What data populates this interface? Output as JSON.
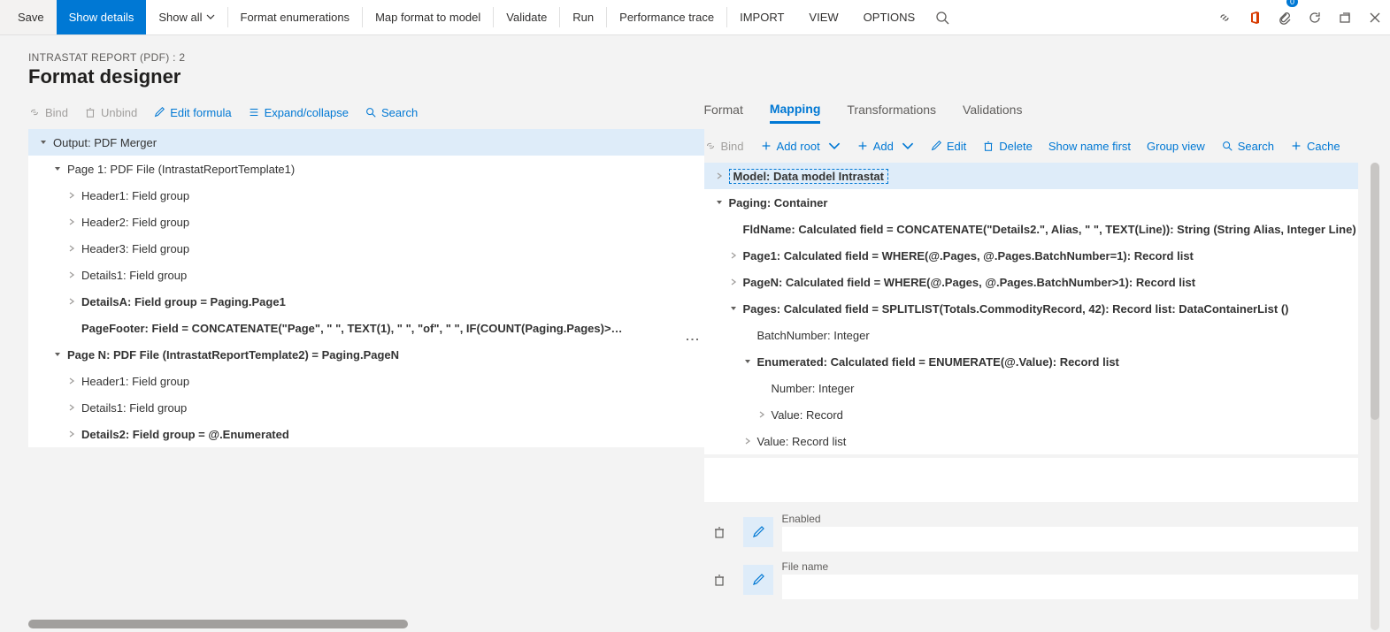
{
  "toolbar": {
    "save": "Save",
    "show_details": "Show details",
    "show_all": "Show all",
    "format_enum": "Format enumerations",
    "map_format": "Map format to model",
    "validate": "Validate",
    "run": "Run",
    "perf_trace": "Performance trace",
    "import": "IMPORT",
    "view": "VIEW",
    "options": "OPTIONS",
    "badge_count": "0"
  },
  "header": {
    "breadcrumb": "INTRASTAT REPORT (PDF) : 2",
    "title": "Format designer"
  },
  "left_toolbar": {
    "bind": "Bind",
    "unbind": "Unbind",
    "edit_formula": "Edit formula",
    "expand": "Expand/collapse",
    "search": "Search"
  },
  "left_tree": [
    {
      "depth": 0,
      "arrow": "down",
      "text": "Output: PDF Merger",
      "selected": true
    },
    {
      "depth": 1,
      "arrow": "down",
      "text": "Page 1: PDF File (IntrastatReportTemplate1)"
    },
    {
      "depth": 2,
      "arrow": "right",
      "text": "Header1: Field group"
    },
    {
      "depth": 2,
      "arrow": "right",
      "text": "Header2: Field group"
    },
    {
      "depth": 2,
      "arrow": "right",
      "text": "Header3: Field group"
    },
    {
      "depth": 2,
      "arrow": "right",
      "text": "Details1: Field group"
    },
    {
      "depth": 2,
      "arrow": "right",
      "text": "DetailsA: Field group = Paging.Page1",
      "bold": true
    },
    {
      "depth": 2,
      "arrow": "blank",
      "text": "PageFooter: Field = CONCATENATE(\"Page\", \" \", TEXT(1), \" \", \"of\", \" \", IF(COUNT(Paging.Pages)>…",
      "bold": true
    },
    {
      "depth": 1,
      "arrow": "down",
      "text": "Page N: PDF File (IntrastatReportTemplate2) = Paging.PageN",
      "bold": true
    },
    {
      "depth": 2,
      "arrow": "right",
      "text": "Header1: Field group"
    },
    {
      "depth": 2,
      "arrow": "right",
      "text": "Details1: Field group"
    },
    {
      "depth": 2,
      "arrow": "right",
      "text": "Details2: Field group = @.Enumerated",
      "bold": true
    }
  ],
  "tabs": {
    "format": "Format",
    "mapping": "Mapping",
    "transformations": "Transformations",
    "validations": "Validations"
  },
  "right_toolbar": {
    "bind": "Bind",
    "add_root": "Add root",
    "add": "Add",
    "edit": "Edit",
    "delete": "Delete",
    "show_name": "Show name first",
    "group_view": "Group view",
    "search": "Search",
    "cache": "Cache"
  },
  "right_tree": [
    {
      "depth": 0,
      "arrow": "right",
      "text": "Model: Data model Intrastat",
      "bold": true,
      "dashed": true
    },
    {
      "depth": 0,
      "arrow": "down",
      "text": "Paging: Container",
      "bold": true
    },
    {
      "depth": 1,
      "arrow": "blank",
      "text": "FldName: Calculated field = CONCATENATE(\"Details2.\", Alias, \" \", TEXT(Line)): String (String Alias, Integer Line)",
      "bold": true
    },
    {
      "depth": 1,
      "arrow": "right",
      "text": "Page1: Calculated field = WHERE(@.Pages, @.Pages.BatchNumber=1): Record list",
      "bold": true
    },
    {
      "depth": 1,
      "arrow": "right",
      "text": "PageN: Calculated field = WHERE(@.Pages, @.Pages.BatchNumber>1): Record list",
      "bold": true
    },
    {
      "depth": 1,
      "arrow": "down",
      "text": "Pages: Calculated field = SPLITLIST(Totals.CommodityRecord, 42): Record list: DataContainerList ()",
      "bold": true
    },
    {
      "depth": 2,
      "arrow": "blank",
      "text": "BatchNumber: Integer"
    },
    {
      "depth": 2,
      "arrow": "down",
      "text": "Enumerated: Calculated field = ENUMERATE(@.Value): Record list",
      "bold": true
    },
    {
      "depth": 3,
      "arrow": "blank",
      "text": "Number: Integer"
    },
    {
      "depth": 3,
      "arrow": "right",
      "text": "Value: Record"
    },
    {
      "depth": 2,
      "arrow": "right",
      "text": "Value: Record list"
    }
  ],
  "props": {
    "enabled_label": "Enabled",
    "enabled_value": "",
    "filename_label": "File name",
    "filename_value": ""
  }
}
